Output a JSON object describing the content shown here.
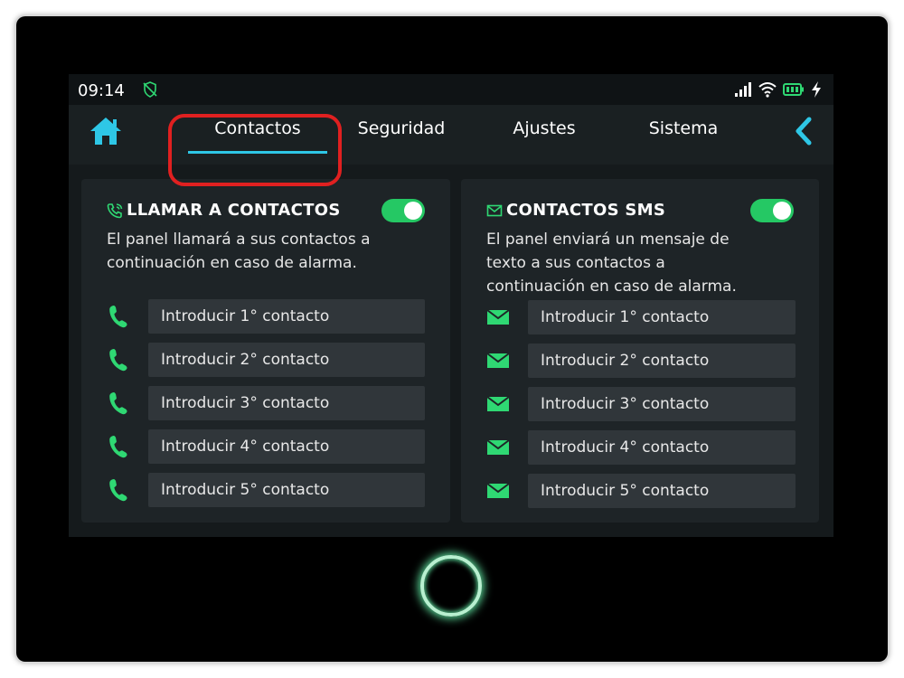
{
  "status_bar": {
    "time": "09:14",
    "icons": [
      "shield-off-icon",
      "signal-icon",
      "wifi-icon",
      "battery-icon",
      "charging-icon"
    ]
  },
  "nav": {
    "home_icon": "home-icon",
    "back_icon": "chevron-left-icon",
    "tabs": [
      {
        "label": "Contactos",
        "active": true
      },
      {
        "label": "Seguridad",
        "active": false
      },
      {
        "label": "Ajustes",
        "active": false
      },
      {
        "label": "Sistema",
        "active": false
      }
    ]
  },
  "call_panel": {
    "title": "LLAMAR A CONTACTOS",
    "icon": "phone-call-icon",
    "enabled": true,
    "description_lines": [
      "El panel llamará a sus contactos a",
      "continuación en caso de alarma."
    ],
    "contacts": [
      {
        "placeholder": "Introducir 1° contacto"
      },
      {
        "placeholder": "Introducir 2° contacto"
      },
      {
        "placeholder": "Introducir 3° contacto"
      },
      {
        "placeholder": "Introducir 4° contacto"
      },
      {
        "placeholder": "Introducir 5° contacto"
      }
    ]
  },
  "sms_panel": {
    "title": "CONTACTOS SMS",
    "icon": "mail-icon",
    "enabled": true,
    "description_lines": [
      "El panel enviará un mensaje de",
      "texto a sus contactos a",
      "continuación en caso de alarma."
    ],
    "contacts": [
      {
        "placeholder": "Introducir 1° contacto"
      },
      {
        "placeholder": "Introducir 2° contacto"
      },
      {
        "placeholder": "Introducir 3° contacto"
      },
      {
        "placeholder": "Introducir 4° contacto"
      },
      {
        "placeholder": "Introducir 5° contacto"
      }
    ]
  },
  "colors": {
    "accent": "#2ec7e6",
    "toggle_on": "#25c864",
    "icon_green": "#2fd873",
    "highlight": "#e02020"
  }
}
